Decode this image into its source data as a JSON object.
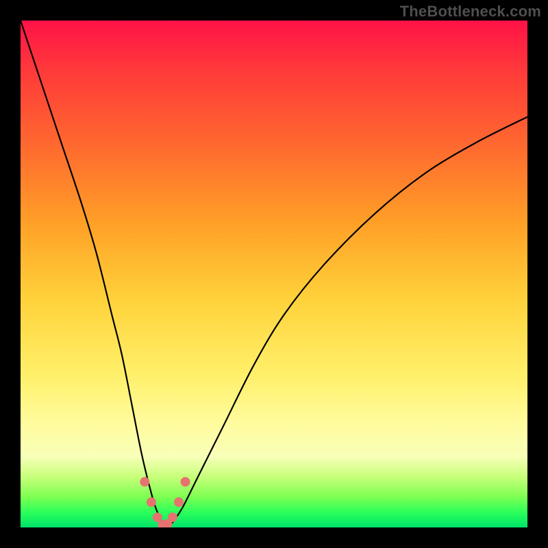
{
  "watermark": "TheBottleneck.com",
  "colors": {
    "frame_border": "#000000",
    "curve_stroke": "#000000",
    "marker_fill": "#e6736f",
    "gradient_top": "#ff1247",
    "gradient_bottom": "#00e36a"
  },
  "chart_data": {
    "type": "line",
    "title": "",
    "xlabel": "",
    "ylabel": "",
    "xlim": [
      0,
      100
    ],
    "ylim": [
      0,
      100
    ],
    "series": [
      {
        "name": "bottleneck-curve",
        "x": [
          0,
          4,
          8,
          12,
          15,
          18,
          20,
          22,
          24,
          26,
          27,
          28,
          29,
          30,
          32,
          35,
          40,
          46,
          52,
          60,
          70,
          80,
          90,
          100
        ],
        "values": [
          100,
          88,
          76,
          64,
          54,
          42,
          34,
          24,
          14,
          6,
          3,
          1,
          0,
          1,
          4,
          10,
          20,
          32,
          42,
          52,
          62,
          70,
          76,
          81
        ]
      }
    ],
    "valley_markers": [
      {
        "x": 24.5,
        "y": 9
      },
      {
        "x": 25.8,
        "y": 5
      },
      {
        "x": 27.0,
        "y": 2
      },
      {
        "x": 28.0,
        "y": 0.5
      },
      {
        "x": 29.0,
        "y": 0.7
      },
      {
        "x": 30.0,
        "y": 2
      },
      {
        "x": 31.2,
        "y": 5
      },
      {
        "x": 32.5,
        "y": 9
      }
    ]
  }
}
